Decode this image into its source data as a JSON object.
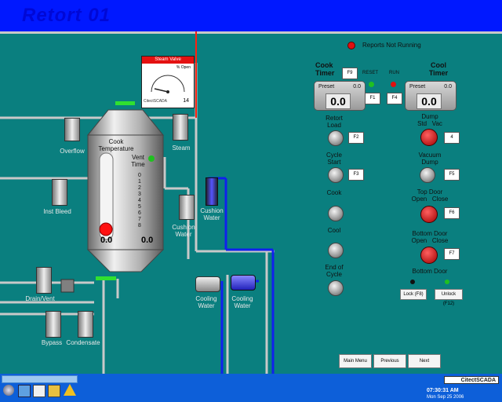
{
  "header": {
    "title": "Retort 01"
  },
  "status": {
    "reports_label": "Reports Not Running",
    "led_color": "#e01010"
  },
  "valve_gauge": {
    "title": "Steam Valve",
    "unit": "% Open",
    "ticks": [
      "0",
      "20",
      "40",
      "60",
      "80",
      "100"
    ],
    "value": "14",
    "brand": "CitectSCADA"
  },
  "vessel": {
    "cook_temp_label": "Cook\nTemperature",
    "cook_temp_value": "0.0",
    "vent_time_label": "Vent\nTime",
    "vent_steps": [
      "0",
      "1",
      "2",
      "3",
      "4",
      "5",
      "6",
      "7",
      "8"
    ],
    "vent_time_value": "0.0"
  },
  "pipes": {
    "overflow": "Overflow",
    "steam": "Steam",
    "inst_bleed": "Inst Bleed",
    "cushion_water_1": "Cushion\nWater",
    "cushion_water_2": "Cushion\nWater",
    "drain_vent": "Drain/Vent",
    "bypass": "Bypass",
    "condensate": "Condensate",
    "cooling_water_1": "Cooling\nWater",
    "cooling_water_2": "Cooling\nWater"
  },
  "cook_timer": {
    "title": "Cook\nTimer",
    "key": "F9",
    "reset_label": "RESET",
    "run_label": "RUN",
    "preset_label": "Preset",
    "preset_value": "0.0",
    "value": "0.0",
    "reset_key": "F1",
    "run_key": "F4"
  },
  "cool_timer": {
    "title": "Cool\nTimer",
    "preset_label": "Preset",
    "preset_value": "0.0",
    "value": "0.0"
  },
  "controls": {
    "retort_load": {
      "label": "Retort\nLoad",
      "key": "F2"
    },
    "cycle_start": {
      "label": "Cycle\nStart",
      "key": "F3"
    },
    "cook": {
      "label": "Cook"
    },
    "cool": {
      "label": "Cool"
    },
    "end_of_cycle": {
      "label": "End of\nCycle"
    },
    "dump": {
      "label": "Dump",
      "sub": "Std   Vac",
      "key": "4"
    },
    "vacuum_dump": {
      "label": "Vacuum\nDump",
      "key": "F5"
    },
    "top_door": {
      "label": "Top Door",
      "sub": "Open   Close",
      "key": "F6"
    },
    "bottom_door_switch": {
      "label": "Bottom Door",
      "sub": "Open   Close",
      "key": "F7"
    },
    "bottom_door": {
      "label": "Bottom Door",
      "lock": "Lock (F8)",
      "unlock": "Unlock (F12)"
    }
  },
  "nav": {
    "main_menu": "Main Menu",
    "previous": "Previous",
    "next": "Next"
  },
  "footer": {
    "brand": "CitectSCADA",
    "time": "07:30:31 AM",
    "date": "Mon Sep 25 2006"
  }
}
